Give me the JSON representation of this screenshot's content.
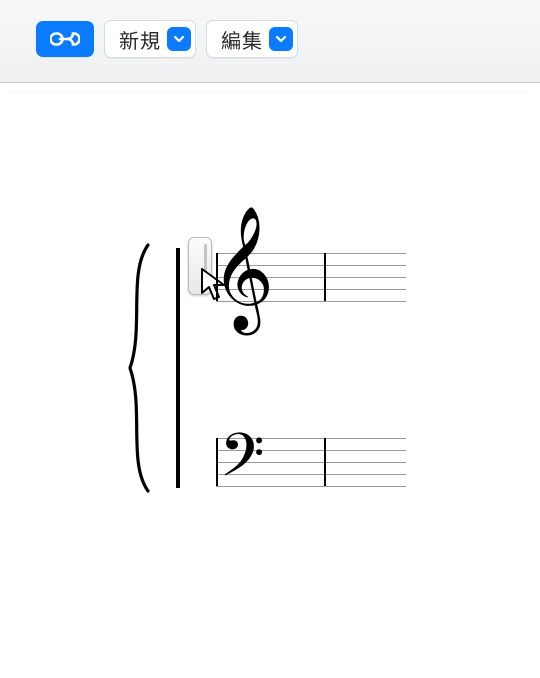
{
  "toolbar": {
    "link_button": "link-button",
    "new_label": "新規",
    "edit_label": "編集"
  },
  "score": {
    "brace_style": "curly",
    "staves": [
      {
        "clef": "treble",
        "clef_glyph": "𝄞",
        "lines": 5
      },
      {
        "clef": "bass",
        "clef_glyph": "𝄢",
        "lines": 5
      }
    ],
    "measures_visible": 2,
    "drag_handle_active": true
  },
  "colors": {
    "accent": "#0a7bff",
    "toolbar_top": "#f8f8fa",
    "toolbar_bottom": "#eef0f2",
    "staff_line": "#9a9a9a"
  }
}
